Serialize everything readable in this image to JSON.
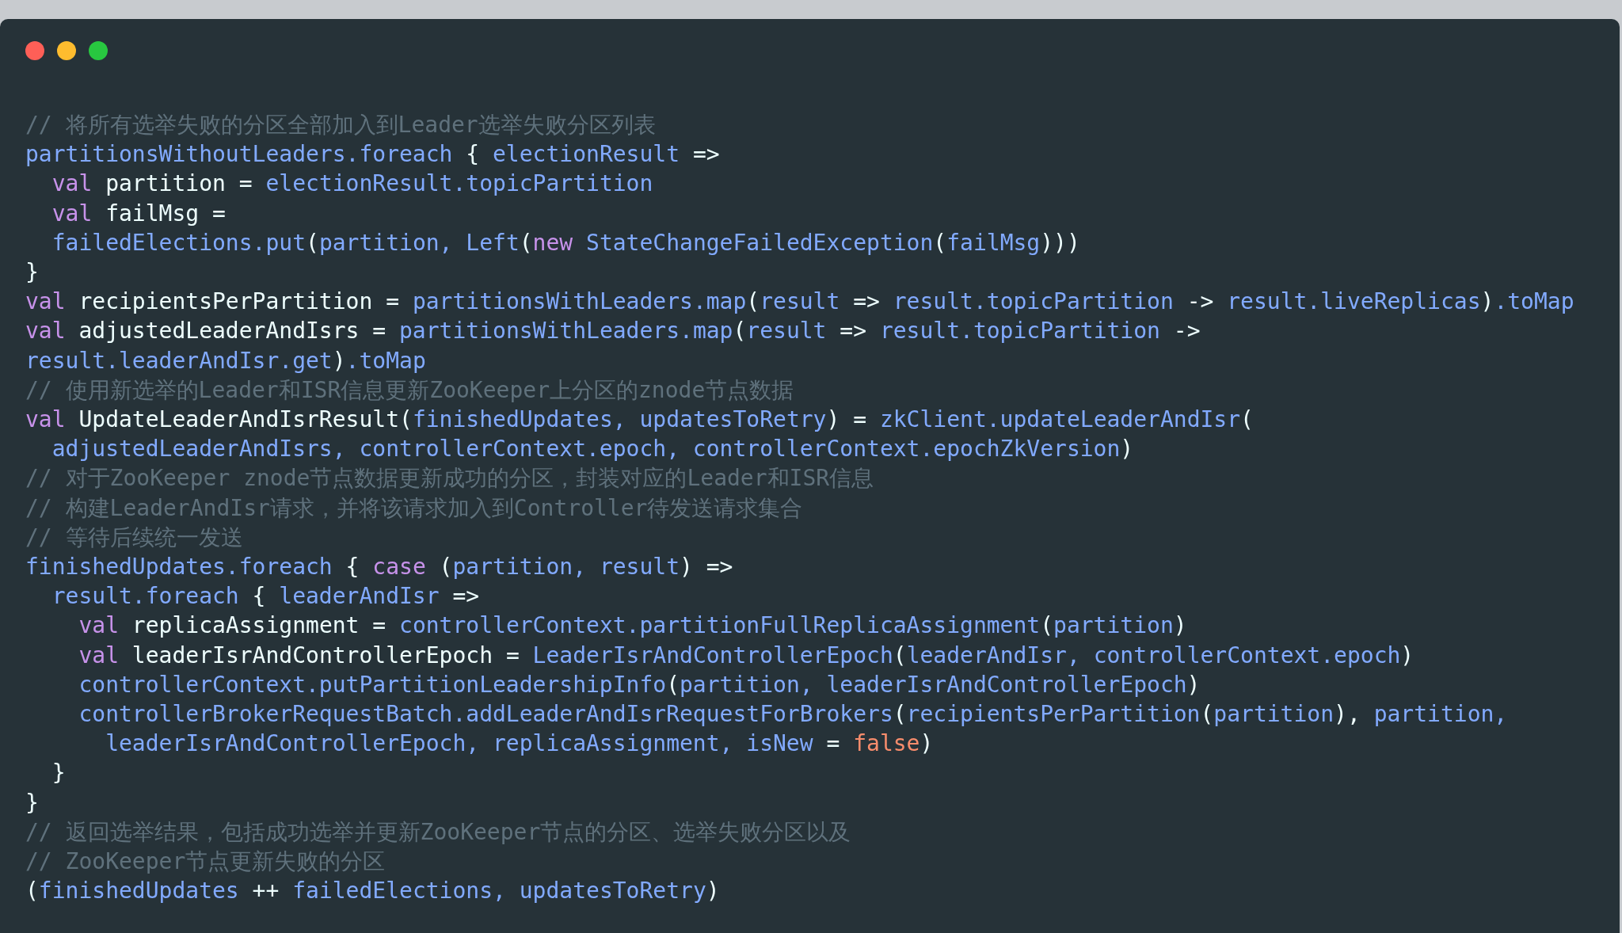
{
  "code": [
    {
      "tokens": [
        {
          "kind": "comment",
          "text": "// 将所有选举失败的分区全部加入到Leader选举失败分区列表"
        }
      ]
    },
    {
      "tokens": [
        {
          "kind": "ident",
          "text": "partitionsWithoutLeaders.foreach"
        },
        {
          "kind": "plain",
          "text": " { "
        },
        {
          "kind": "ident",
          "text": "electionResult"
        },
        {
          "kind": "plain",
          "text": " =>"
        }
      ]
    },
    {
      "tokens": [
        {
          "kind": "keyword",
          "text": "  val"
        },
        {
          "kind": "plain",
          "text": " partition = "
        },
        {
          "kind": "ident",
          "text": "electionResult.topicPartition"
        }
      ]
    },
    {
      "tokens": [
        {
          "kind": "keyword",
          "text": "  val"
        },
        {
          "kind": "plain",
          "text": " failMsg ="
        }
      ]
    },
    {
      "tokens": [
        {
          "kind": "ident",
          "text": "  failedElections.put"
        },
        {
          "kind": "plain",
          "text": "("
        },
        {
          "kind": "ident",
          "text": "partition, Left"
        },
        {
          "kind": "plain",
          "text": "("
        },
        {
          "kind": "keyword",
          "text": "new"
        },
        {
          "kind": "ident",
          "text": " StateChangeFailedException"
        },
        {
          "kind": "plain",
          "text": "("
        },
        {
          "kind": "ident",
          "text": "failMsg"
        },
        {
          "kind": "plain",
          "text": ")))"
        }
      ]
    },
    {
      "tokens": [
        {
          "kind": "plain",
          "text": "}"
        }
      ]
    },
    {
      "tokens": [
        {
          "kind": "keyword",
          "text": "val"
        },
        {
          "kind": "plain",
          "text": " recipientsPerPartition = "
        },
        {
          "kind": "ident",
          "text": "partitionsWithLeaders.map"
        },
        {
          "kind": "plain",
          "text": "("
        },
        {
          "kind": "ident",
          "text": "result"
        },
        {
          "kind": "plain",
          "text": " => "
        },
        {
          "kind": "ident",
          "text": "result.topicPartition"
        },
        {
          "kind": "plain",
          "text": " -> "
        },
        {
          "kind": "ident",
          "text": "result.liveReplicas"
        },
        {
          "kind": "plain",
          "text": ")"
        },
        {
          "kind": "ident",
          "text": ".toMap"
        }
      ]
    },
    {
      "tokens": [
        {
          "kind": "keyword",
          "text": "val"
        },
        {
          "kind": "plain",
          "text": " adjustedLeaderAndIsrs = "
        },
        {
          "kind": "ident",
          "text": "partitionsWithLeaders.map"
        },
        {
          "kind": "plain",
          "text": "("
        },
        {
          "kind": "ident",
          "text": "result"
        },
        {
          "kind": "plain",
          "text": " => "
        },
        {
          "kind": "ident",
          "text": "result.topicPartition"
        },
        {
          "kind": "plain",
          "text": " ->"
        }
      ]
    },
    {
      "tokens": [
        {
          "kind": "ident",
          "text": "result.leaderAndIsr.get"
        },
        {
          "kind": "plain",
          "text": ")"
        },
        {
          "kind": "ident",
          "text": ".toMap"
        }
      ]
    },
    {
      "tokens": [
        {
          "kind": "comment",
          "text": "// 使用新选举的Leader和ISR信息更新ZooKeeper上分区的znode节点数据"
        }
      ]
    },
    {
      "tokens": [
        {
          "kind": "keyword",
          "text": "val"
        },
        {
          "kind": "plain",
          "text": " UpdateLeaderAndIsrResult("
        },
        {
          "kind": "ident",
          "text": "finishedUpdates, updatesToRetry"
        },
        {
          "kind": "plain",
          "text": ") = "
        },
        {
          "kind": "ident",
          "text": "zkClient.updateLeaderAndIsr"
        },
        {
          "kind": "plain",
          "text": "("
        }
      ]
    },
    {
      "tokens": [
        {
          "kind": "ident",
          "text": "  adjustedLeaderAndIsrs, controllerContext.epoch, controllerContext.epochZkVersion"
        },
        {
          "kind": "plain",
          "text": ")"
        }
      ]
    },
    {
      "tokens": [
        {
          "kind": "comment",
          "text": "// 对于ZooKeeper znode节点数据更新成功的分区，封装对应的Leader和ISR信息"
        }
      ]
    },
    {
      "tokens": [
        {
          "kind": "comment",
          "text": "// 构建LeaderAndIsr请求，并将该请求加入到Controller待发送请求集合"
        }
      ]
    },
    {
      "tokens": [
        {
          "kind": "comment",
          "text": "// 等待后续统一发送"
        }
      ]
    },
    {
      "tokens": [
        {
          "kind": "ident",
          "text": "finishedUpdates.foreach"
        },
        {
          "kind": "plain",
          "text": " { "
        },
        {
          "kind": "keyword",
          "text": "case"
        },
        {
          "kind": "plain",
          "text": " ("
        },
        {
          "kind": "ident",
          "text": "partition, result"
        },
        {
          "kind": "plain",
          "text": ") =>"
        }
      ]
    },
    {
      "tokens": [
        {
          "kind": "ident",
          "text": "  result.foreach"
        },
        {
          "kind": "plain",
          "text": " { "
        },
        {
          "kind": "ident",
          "text": "leaderAndIsr"
        },
        {
          "kind": "plain",
          "text": " =>"
        }
      ]
    },
    {
      "tokens": [
        {
          "kind": "keyword",
          "text": "    val"
        },
        {
          "kind": "plain",
          "text": " replicaAssignment = "
        },
        {
          "kind": "ident",
          "text": "controllerContext.partitionFullReplicaAssignment"
        },
        {
          "kind": "plain",
          "text": "("
        },
        {
          "kind": "ident",
          "text": "partition"
        },
        {
          "kind": "plain",
          "text": ")"
        }
      ]
    },
    {
      "tokens": [
        {
          "kind": "keyword",
          "text": "    val"
        },
        {
          "kind": "plain",
          "text": " leaderIsrAndControllerEpoch = "
        },
        {
          "kind": "ident",
          "text": "LeaderIsrAndControllerEpoch"
        },
        {
          "kind": "plain",
          "text": "("
        },
        {
          "kind": "ident",
          "text": "leaderAndIsr, controllerContext.epoch"
        },
        {
          "kind": "plain",
          "text": ")"
        }
      ]
    },
    {
      "tokens": [
        {
          "kind": "ident",
          "text": "    controllerContext.putPartitionLeadershipInfo"
        },
        {
          "kind": "plain",
          "text": "("
        },
        {
          "kind": "ident",
          "text": "partition, leaderIsrAndControllerEpoch"
        },
        {
          "kind": "plain",
          "text": ")"
        }
      ]
    },
    {
      "tokens": [
        {
          "kind": "ident",
          "text": "    controllerBrokerRequestBatch.addLeaderAndIsrRequestForBrokers"
        },
        {
          "kind": "plain",
          "text": "("
        },
        {
          "kind": "ident",
          "text": "recipientsPerPartition"
        },
        {
          "kind": "plain",
          "text": "("
        },
        {
          "kind": "ident",
          "text": "partition"
        },
        {
          "kind": "plain",
          "text": "), "
        },
        {
          "kind": "ident",
          "text": "partition,"
        }
      ]
    },
    {
      "tokens": [
        {
          "kind": "ident",
          "text": "      leaderIsrAndControllerEpoch, replicaAssignment, isNew"
        },
        {
          "kind": "plain",
          "text": " = "
        },
        {
          "kind": "literal",
          "text": "false"
        },
        {
          "kind": "plain",
          "text": ")"
        }
      ]
    },
    {
      "tokens": [
        {
          "kind": "plain",
          "text": "  }"
        }
      ]
    },
    {
      "tokens": [
        {
          "kind": "plain",
          "text": "}"
        }
      ]
    },
    {
      "tokens": [
        {
          "kind": "comment",
          "text": "// 返回选举结果，包括成功选举并更新ZooKeeper节点的分区、选举失败分区以及"
        }
      ]
    },
    {
      "tokens": [
        {
          "kind": "comment",
          "text": "// ZooKeeper节点更新失败的分区"
        }
      ]
    },
    {
      "tokens": [
        {
          "kind": "plain",
          "text": "("
        },
        {
          "kind": "ident",
          "text": "finishedUpdates"
        },
        {
          "kind": "plain",
          "text": " ++ "
        },
        {
          "kind": "ident",
          "text": "failedElections, updatesToRetry"
        },
        {
          "kind": "plain",
          "text": ")"
        }
      ]
    }
  ]
}
